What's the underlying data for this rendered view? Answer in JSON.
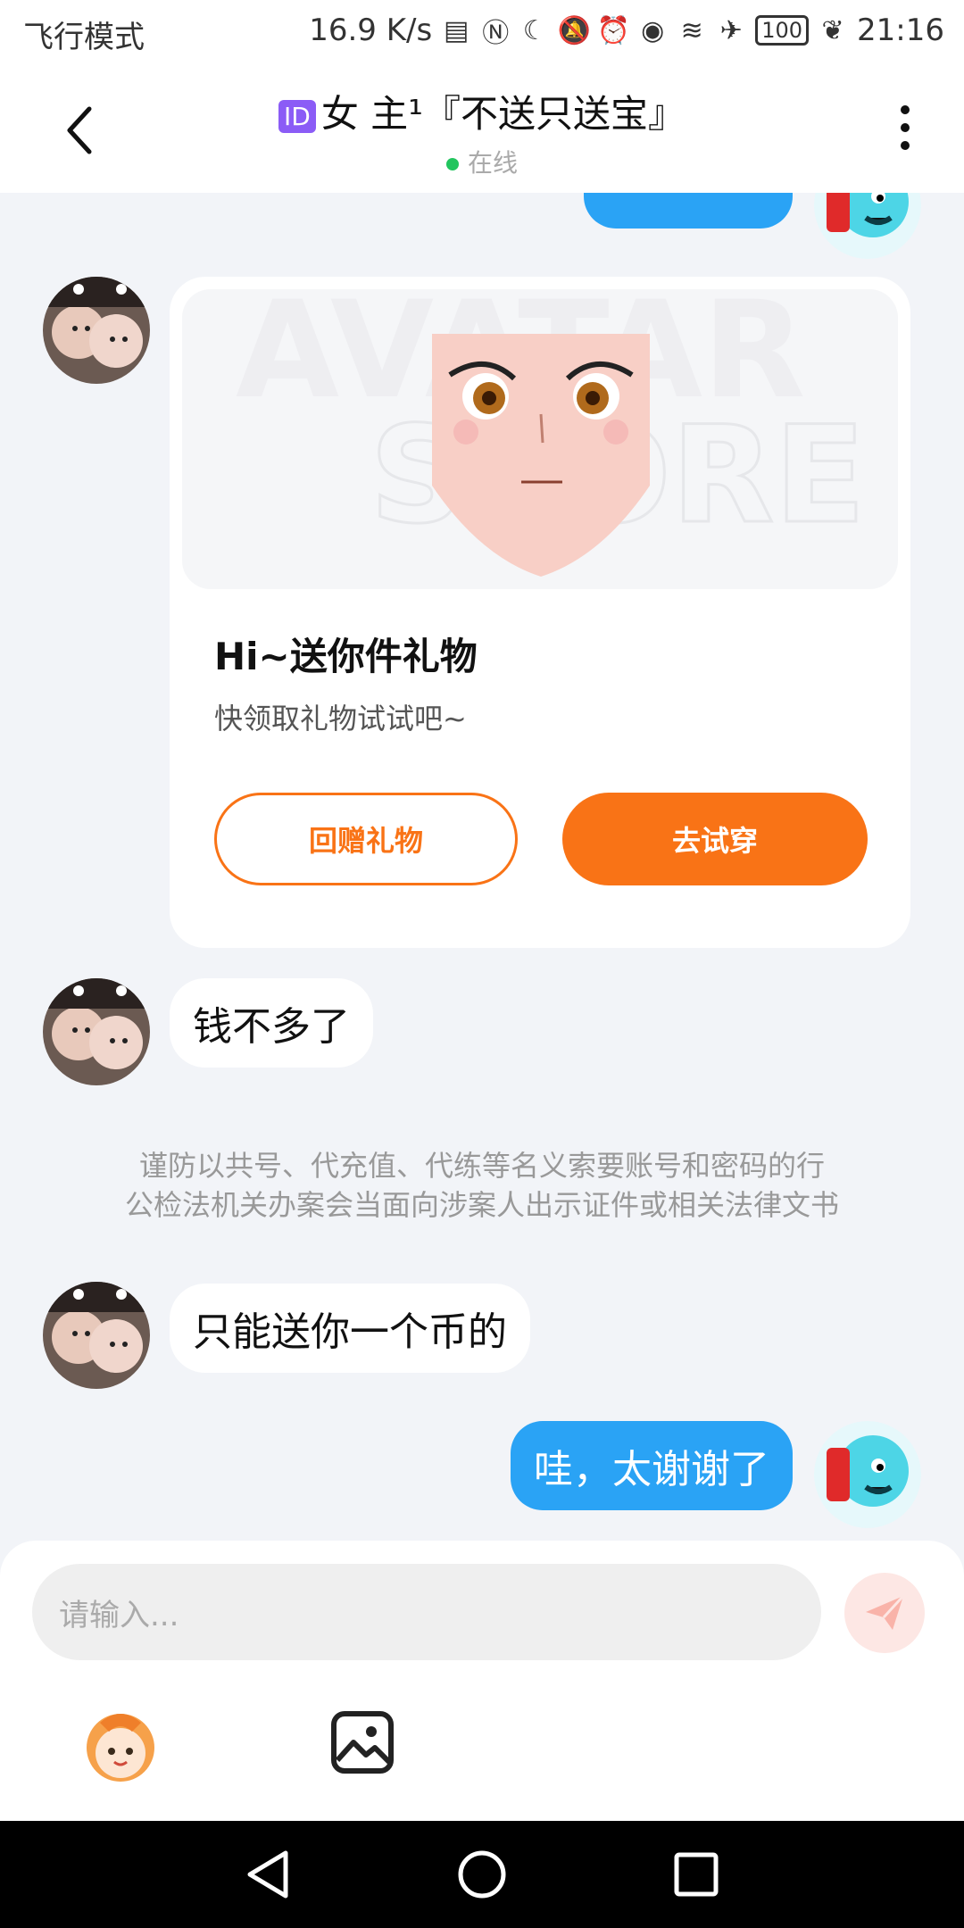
{
  "status_bar": {
    "mode": "飞行模式",
    "speed": "16.9 K/s",
    "battery": "100",
    "time": "21:16"
  },
  "header": {
    "id_badge": "ID",
    "title": "女 主¹『不送只送宝』",
    "status": "在线"
  },
  "gift_card": {
    "title": "Hi~送你件礼物",
    "subtitle": "快领取礼物试试吧~",
    "return_gift_label": "回赠礼物",
    "try_on_label": "去试穿"
  },
  "messages": {
    "m1": "钱不多了",
    "m2": "只能送你一个币的",
    "m3": "哇，太谢谢了"
  },
  "notice": {
    "line1": "谨防以共号、代充值、代练等名义索要账号和密码的行",
    "line2": "公检法机关办案会当面向涉案人出示证件或相关法律文书"
  },
  "composer": {
    "placeholder": "请输入..."
  },
  "colors": {
    "accent": "#f97316",
    "sent_bubble": "#2aa3f5",
    "background": "#f2f4f8"
  }
}
